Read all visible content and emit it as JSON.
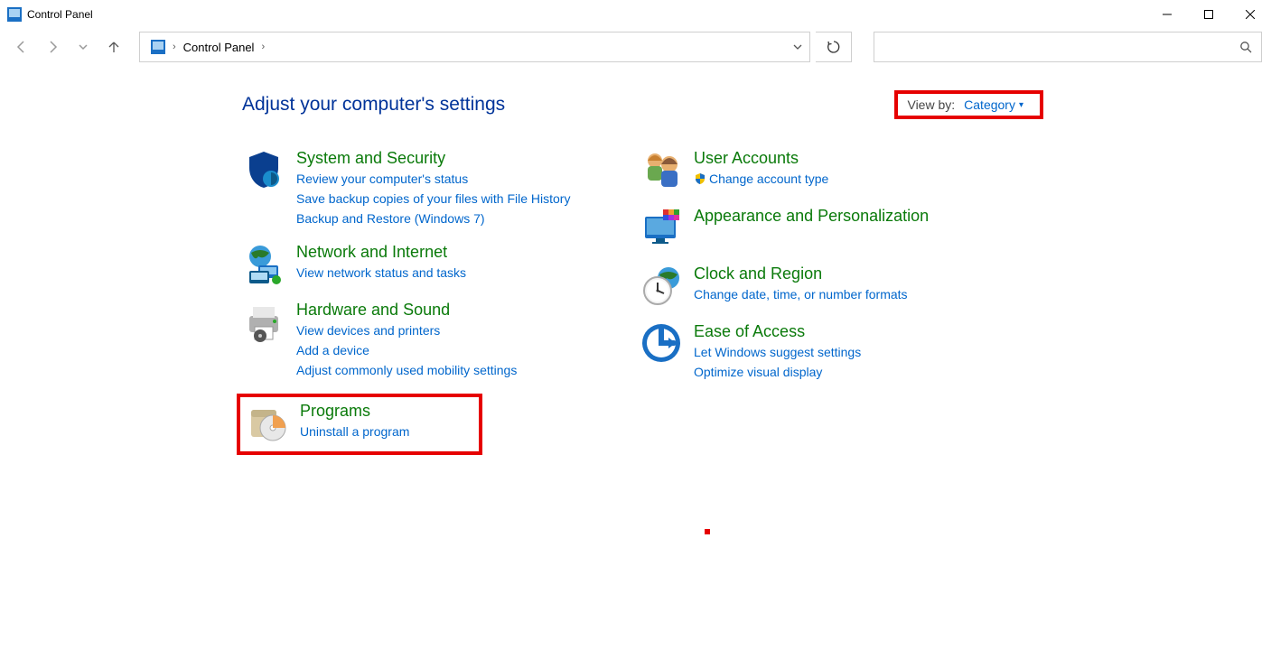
{
  "window": {
    "title": "Control Panel"
  },
  "breadcrumb": {
    "root": "Control Panel"
  },
  "search": {
    "placeholder": ""
  },
  "heading": "Adjust your computer's settings",
  "viewby": {
    "label": "View by:",
    "value": "Category"
  },
  "left_categories": {
    "system_security": {
      "title": "System and Security",
      "l1": "Review your computer's status",
      "l2": "Save backup copies of your files with File History",
      "l3": "Backup and Restore (Windows 7)"
    },
    "network": {
      "title": "Network and Internet",
      "l1": "View network status and tasks"
    },
    "hardware": {
      "title": "Hardware and Sound",
      "l1": "View devices and printers",
      "l2": "Add a device",
      "l3": "Adjust commonly used mobility settings"
    },
    "programs": {
      "title": "Programs",
      "l1": "Uninstall a program"
    }
  },
  "right_categories": {
    "user_accounts": {
      "title": "User Accounts",
      "l1": "Change account type"
    },
    "appearance": {
      "title": "Appearance and Personalization"
    },
    "clock": {
      "title": "Clock and Region",
      "l1": "Change date, time, or number formats"
    },
    "ease": {
      "title": "Ease of Access",
      "l1": "Let Windows suggest settings",
      "l2": "Optimize visual display"
    }
  }
}
